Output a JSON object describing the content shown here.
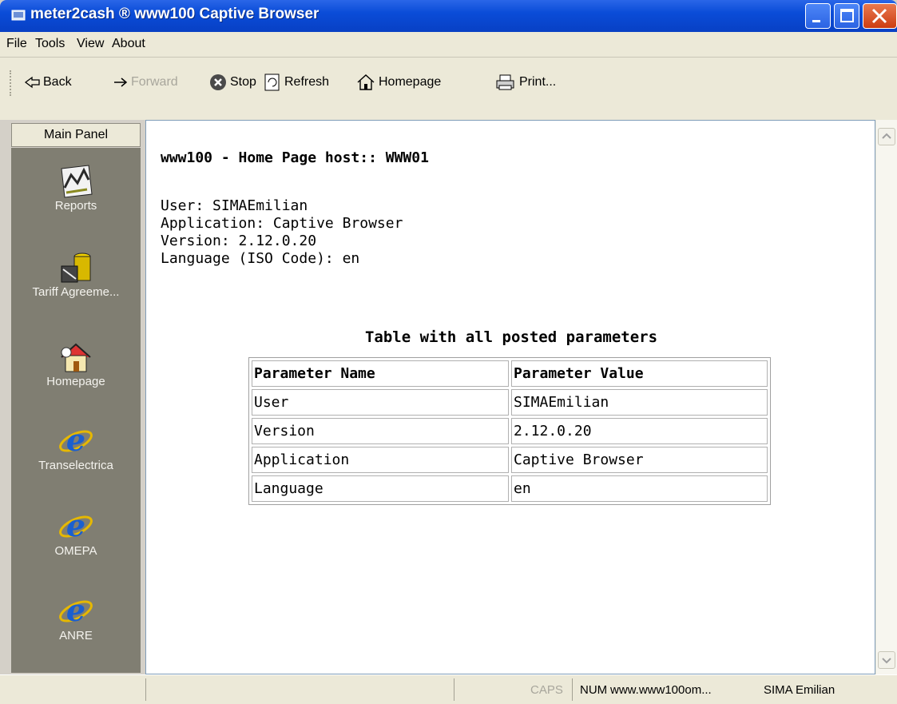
{
  "window": {
    "title": "meter2cash ® www100 Captive Browser"
  },
  "menu": [
    "File",
    "Tools",
    "View",
    "About"
  ],
  "toolbar": {
    "back": "Back",
    "forward": "Forward",
    "stop": "Stop",
    "refresh": "Refresh",
    "homepage": "Homepage",
    "print": "Print..."
  },
  "sidebar": {
    "panel_label": "Main Panel",
    "items": [
      {
        "label": "Reports",
        "icon": "reports-icon"
      },
      {
        "label": "Tariff Agreeme...",
        "icon": "tariff-icon"
      },
      {
        "label": "Homepage",
        "icon": "house-icon"
      },
      {
        "label": "Transelectrica",
        "icon": "ie-icon"
      },
      {
        "label": "OMEPA",
        "icon": "ie-icon"
      },
      {
        "label": "ANRE",
        "icon": "ie-icon"
      }
    ]
  },
  "page": {
    "heading": "www100 - Home Page host:: WWW01",
    "info": [
      "User: SIMAEmilian",
      "Application: Captive Browser",
      "Version: 2.12.0.20",
      "Language (ISO Code): en"
    ],
    "table_caption": "Table with all posted parameters",
    "table_headers": [
      "Parameter Name",
      "Parameter Value"
    ],
    "table_rows": [
      [
        "User",
        "SIMAEmilian"
      ],
      [
        "Version",
        "2.12.0.20"
      ],
      [
        "Application",
        "Captive Browser"
      ],
      [
        "Language",
        "en"
      ]
    ]
  },
  "status": {
    "caps": "CAPS",
    "num": "NUM",
    "url": "www.www100om...",
    "user": "SIMA Emilian"
  },
  "colors": {
    "titlebar": "#0a4cd8",
    "sidebar": "#807e72",
    "chrome": "#ece9d8"
  }
}
